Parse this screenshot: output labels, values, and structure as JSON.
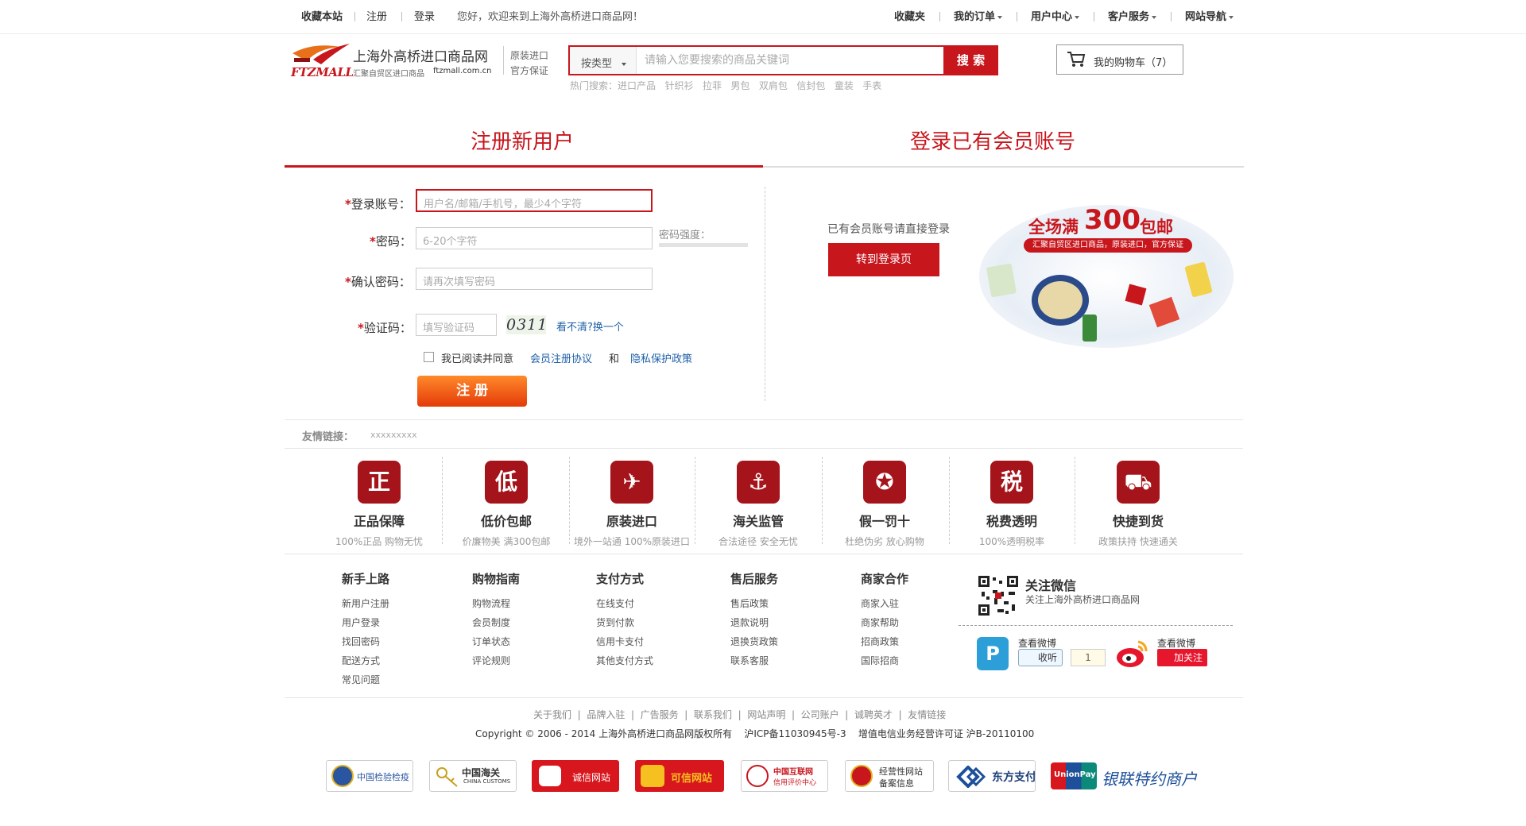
{
  "topbar": {
    "bookmark": "收藏本站",
    "register": "注册",
    "login": "登录",
    "welcome": "您好，欢迎来到上海外高桥进口商品网！",
    "favorites": "收藏夹",
    "my_orders": "我的订单",
    "user_center": "用户中心",
    "customer_service": "客户服务",
    "site_nav": "网站导航"
  },
  "header": {
    "logo_brand": "FTZMALL",
    "logo_cn": "上海外高桥进口商品网",
    "logo_sub": "汇聚自贸区进口商品",
    "logo_url": "ftzmall.com.cn",
    "slogan1": "原装进口",
    "slogan2": "官方保证",
    "search_type": "按类型",
    "search_placeholder": "请输入您要搜索的商品关键词",
    "search_button": "搜 索",
    "hot_label": "热门搜索：",
    "hot_items": [
      "进口产品",
      "针织衫",
      "拉菲",
      "男包",
      "双肩包",
      "信封包",
      "童装",
      "手表"
    ],
    "cart": "我的购物车（7）"
  },
  "tabs": {
    "register": "注册新用户",
    "login": "登录已有会员账号"
  },
  "form": {
    "account_label": "登录账号：",
    "account_placeholder": "用户名/邮箱/手机号，最少4个字符",
    "password_label": "密码：",
    "password_placeholder": "6-20个字符",
    "strength_label": "密码强度：",
    "confirm_label": "确认密码：",
    "confirm_placeholder": "请再次填写密码",
    "captcha_label": "验证码：",
    "captcha_placeholder": "填写验证码",
    "captcha_value": "0311",
    "captcha_refresh": "看不清?换一个",
    "agree_text": "我已阅读并同意",
    "agreement_link": "会员注册协议",
    "and": "和",
    "privacy_link": "隐私保护政策",
    "submit": "注 册"
  },
  "login_side": {
    "hint": "已有会员账号请直接登录",
    "button": "转到登录页",
    "promo_title": "全场满",
    "promo_number": "300",
    "promo_suffix": "包邮",
    "promo_sub": "汇聚自贸区进口商品，原装进口，官方保证"
  },
  "friend_links": {
    "label": "友情链接：",
    "value": "xxxxxxxxx"
  },
  "features": [
    {
      "title": "正品保障",
      "sub": "100%正品  购物无忧",
      "icon_char": "正"
    },
    {
      "title": "低价包邮",
      "sub": "价廉物美  满300包邮",
      "icon_char": "低"
    },
    {
      "title": "原装进口",
      "sub": "境外一站通  100%原装进口",
      "icon_char": "✈"
    },
    {
      "title": "海关监管",
      "sub": "合法途径  安全无忧",
      "icon_char": "⚓"
    },
    {
      "title": "假一罚十",
      "sub": "杜绝伪劣  放心购物",
      "icon_char": "✪"
    },
    {
      "title": "税费透明",
      "sub": "100%透明税率",
      "icon_char": "税"
    },
    {
      "title": "快捷到货",
      "sub": "政策扶持  快速通关",
      "icon_char": "⛟"
    }
  ],
  "footer_cols": [
    {
      "title": "新手上路",
      "items": [
        "新用户注册",
        "用户登录",
        "找回密码",
        "配送方式",
        "常见问题"
      ]
    },
    {
      "title": "购物指南",
      "items": [
        "购物流程",
        "会员制度",
        "订单状态",
        "评论规则"
      ]
    },
    {
      "title": "支付方式",
      "items": [
        "在线支付",
        "货到付款",
        "信用卡支付",
        "其他支付方式"
      ]
    },
    {
      "title": "售后服务",
      "items": [
        "售后政策",
        "退款说明",
        "退换货政策",
        "联系客服"
      ]
    },
    {
      "title": "商家合作",
      "items": [
        "商家入驻",
        "商家帮助",
        "招商政策",
        "国际招商"
      ]
    }
  ],
  "wechat": {
    "title": "关注微信",
    "sub": "关注上海外高桥进口商品网"
  },
  "weibo": {
    "tencent_label": "查看微博",
    "tencent_btn": "收听",
    "tencent_count": "1",
    "sina_label": "查看微博",
    "sina_btn": "加关注"
  },
  "bottom_links": [
    "关于我们",
    "品牌入驻",
    "广告服务",
    "联系我们",
    "网站声明",
    "公司账户",
    "诚聘英才",
    "友情链接"
  ],
  "copyright": {
    "left": "Copyright © 2006 - 2014 上海外高桥进口商品网版权所有",
    "icp": "沪ICP备11030945号-3",
    "license": "增值电信业务经营许可证 沪B-20110100"
  },
  "badges": [
    {
      "text": "中国检验检疫"
    },
    {
      "text": "中国海关",
      "sub": "CHINA CUSTOMS"
    },
    {
      "text": "诚信网站"
    },
    {
      "text": "可信网站"
    },
    {
      "text": "中国互联网",
      "sub": "信用评价中心"
    },
    {
      "text": "经营性网站",
      "sub": "备案信息"
    },
    {
      "text": "东方支付"
    },
    {
      "text": "银联特约商户",
      "sub": "UnionPay"
    }
  ],
  "colors": {
    "brand_red": "#c8161d",
    "dark_red": "#a5141a",
    "link_blue": "#1d5fa8",
    "orange": "#ff6a00"
  }
}
